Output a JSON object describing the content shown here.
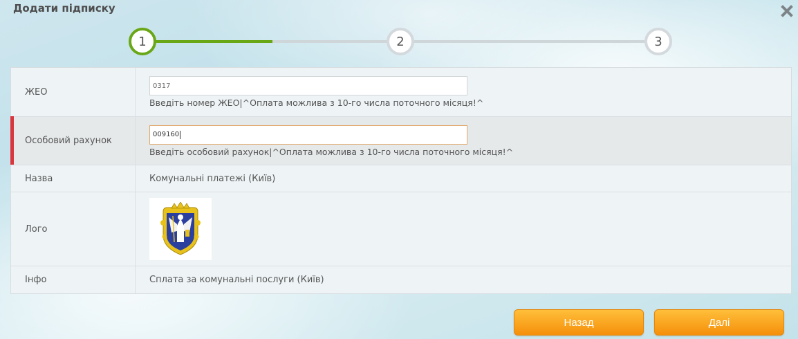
{
  "dialog": {
    "title": "Додати підписку",
    "close_icon": "close-icon"
  },
  "stepper": {
    "steps": [
      "1",
      "2",
      "3"
    ],
    "current_step": 1
  },
  "form": {
    "rows": [
      {
        "label": "ЖЕО",
        "value": "0317",
        "hint": "Введіть номер ЖЕО|^Оплата можлива з 10-го числа поточного місяця!^"
      },
      {
        "label": "Особовий рахунок",
        "value": "009160",
        "hint": "Введіть особовий рахунок|^Оплата можлива з 10-го числа поточного місяця!^"
      },
      {
        "label": "Назва",
        "value": "Комунальні платежі (Київ)"
      },
      {
        "label": "Лого",
        "logo_icon": "kyiv-coat-of-arms-logo"
      },
      {
        "label": "Інфо",
        "value": "Сплата за комунальні послуги (Київ)"
      }
    ]
  },
  "buttons": {
    "back_label": "Назад",
    "next_label": "Далі"
  },
  "colors": {
    "accent_green": "#6aa716",
    "button_orange": "#f5960f",
    "error_marker": "#d9363e"
  }
}
